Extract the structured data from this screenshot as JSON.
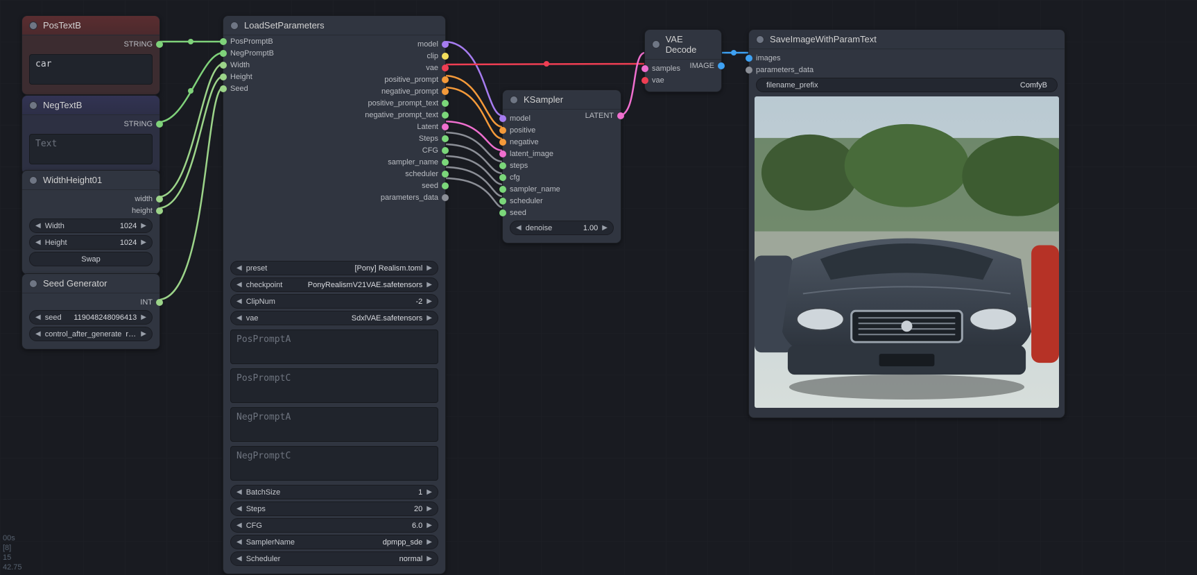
{
  "nodes": {
    "posTextB": {
      "title": "PosTextB",
      "out_label": "STRING",
      "text": "car"
    },
    "negTextB": {
      "title": "NegTextB",
      "out_label": "STRING",
      "placeholder": "Text"
    },
    "widthHeight": {
      "title": "WidthHeight01",
      "out_width": "width",
      "out_height": "height",
      "w_label": "Width",
      "w_value": "1024",
      "h_label": "Height",
      "h_value": "1024",
      "swap": "Swap"
    },
    "seedGen": {
      "title": "Seed Generator",
      "out_label": "INT",
      "seed_label": "seed",
      "seed_value": "119048248096413",
      "ctrl_label": "control_after_generate",
      "ctrl_value": "rand…"
    },
    "loadSet": {
      "title": "LoadSetParameters",
      "inputs": [
        "PosPromptB",
        "NegPromptB",
        "Width",
        "Height",
        "Seed"
      ],
      "outputs": [
        "model",
        "clip",
        "vae",
        "positive_prompt",
        "negative_prompt",
        "positive_prompt_text",
        "negative_prompt_text",
        "Latent",
        "Steps",
        "CFG",
        "sampler_name",
        "scheduler",
        "seed",
        "parameters_data"
      ],
      "preset_label": "preset",
      "preset_value": "[Pony] Realism.toml",
      "checkpoint_label": "checkpoint",
      "checkpoint_value": "PonyRealismV21VAE.safetensors",
      "clipnum_label": "ClipNum",
      "clipnum_value": "-2",
      "vae_label": "vae",
      "vae_value": "SdxlVAE.safetensors",
      "posA_ph": "PosPromptA",
      "posC_ph": "PosPromptC",
      "negA_ph": "NegPromptA",
      "negC_ph": "NegPromptC",
      "batch_label": "BatchSize",
      "batch_value": "1",
      "steps_label": "Steps",
      "steps_value": "20",
      "cfg_label": "CFG",
      "cfg_value": "6.0",
      "sampler_label": "SamplerName",
      "sampler_value": "dpmpp_sde",
      "sched_label": "Scheduler",
      "sched_value": "normal"
    },
    "ksampler": {
      "title": "KSampler",
      "out_label": "LATENT",
      "inputs": [
        "model",
        "positive",
        "negative",
        "latent_image",
        "steps",
        "cfg",
        "sampler_name",
        "scheduler",
        "seed"
      ],
      "denoise_label": "denoise",
      "denoise_value": "1.00"
    },
    "vaeDecode": {
      "title": "VAE Decode",
      "inputs": [
        "samples",
        "vae"
      ],
      "out_label": "IMAGE"
    },
    "saveImage": {
      "title": "SaveImageWithParamText",
      "inputs": [
        "images",
        "parameters_data"
      ],
      "prefix_label": "filename_prefix",
      "prefix_value": "ComfyB"
    }
  },
  "status": {
    "l1": "00s",
    "l2": "[8]",
    "l3": "15",
    "l4": "42.75"
  }
}
